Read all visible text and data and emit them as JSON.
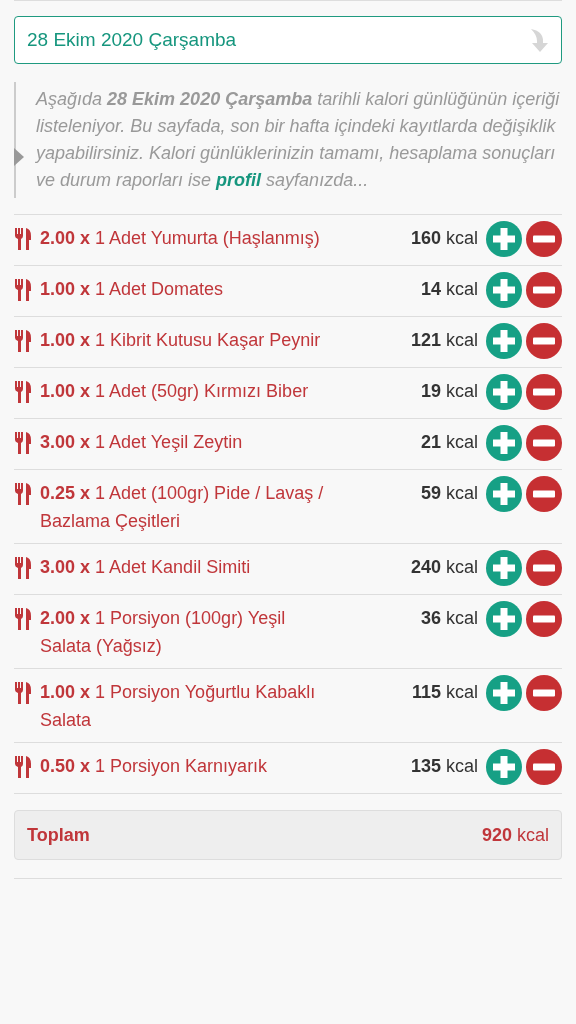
{
  "date_select": {
    "value": "28 Ekim 2020 Çarşamba"
  },
  "note": {
    "text": "Aşağıda **28 Ekim 2020 Çarşamba** tarihli kalori günlüğünün içeriği listeleniyor. Bu sayfada, son bir hafta içindeki kayıtlarda değişiklik yapabilirsiniz. Kalori günlüklerinizin tamamı, hesaplama sonuçları ve durum raporları ise",
    "link": "profil",
    "text_after": "sayfanızda..."
  },
  "entries": [
    {
      "food": "**2.00 x** 1 Adet Yumurta (Haşlanmış)",
      "kcal": "**160** kcal"
    },
    {
      "food": "**1.00 x** 1 Adet Domates",
      "kcal": "**14** kcal"
    },
    {
      "food": "**1.00 x** 1 Kibrit Kutusu Kaşar Peynir",
      "kcal": "**121** kcal"
    },
    {
      "food": "**1.00 x** 1 Adet (50gr) Kırmızı Biber",
      "kcal": "**19** kcal"
    },
    {
      "food": "**3.00 x** 1 Adet Yeşil Zeytin",
      "kcal": "**21** kcal"
    },
    {
      "food": "**0.25 x** 1 Adet (100gr) Pide / Lavaş / Bazlama Çeşitleri",
      "kcal": "**59** kcal"
    },
    {
      "food": "**3.00 x** 1 Adet Kandil Simiti",
      "kcal": "**240** kcal"
    },
    {
      "food": "**2.00 x** 1 Porsiyon (100gr) Yeşil Salata (Yağsız)",
      "kcal": "**36** kcal"
    },
    {
      "food": "**1.00 x** 1 Porsiyon Yoğurtlu Kabaklı Salata",
      "kcal": "**115** kcal"
    },
    {
      "food": "**0.50 x** 1 Porsiyon Karnıyarık",
      "kcal": "**135** kcal"
    }
  ],
  "total": {
    "label": "Toplam",
    "value": "**920** kcal"
  }
}
